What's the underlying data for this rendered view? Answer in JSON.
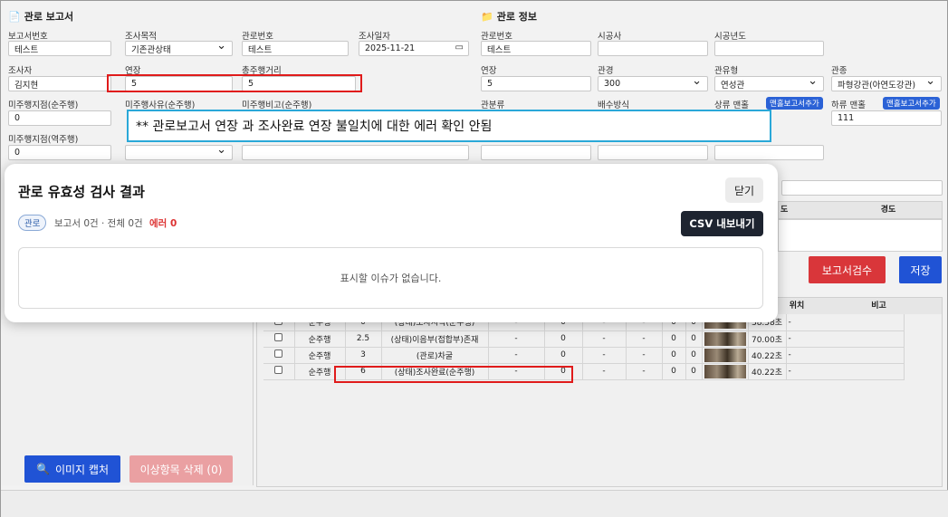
{
  "report": {
    "title": "관로 보고서",
    "fields": {
      "report_no": {
        "label": "보고서번호",
        "value": "테스트"
      },
      "purpose": {
        "label": "조사목적",
        "value": "기존관상태"
      },
      "pipe_no": {
        "label": "관로번호",
        "value": "테스트"
      },
      "date": {
        "label": "조사일자",
        "value": "2025-11-21"
      },
      "inspector": {
        "label": "조사자",
        "value": "김지현"
      },
      "length": {
        "label": "연장",
        "value": "5"
      },
      "total_distance": {
        "label": "총주행거리",
        "value": "5"
      },
      "unrun_point_fwd": {
        "label": "미주행지점(순주행)",
        "value": "0"
      },
      "unrun_reason_fwd": {
        "label": "미주행사유(순주행)",
        "value": ""
      },
      "unrun_note_fwd": {
        "label": "미주행비고(순주행)",
        "value": ""
      },
      "unrun_point_rev": {
        "label": "미주행지점(역주행)",
        "value": "0"
      }
    }
  },
  "pipe_info": {
    "title": "관로 정보",
    "fields": {
      "pipe_no": {
        "label": "관로번호",
        "value": "테스트"
      },
      "contractor": {
        "label": "시공사",
        "value": ""
      },
      "year": {
        "label": "시공년도",
        "value": ""
      },
      "length": {
        "label": "연장",
        "value": "5"
      },
      "diameter": {
        "label": "관경",
        "value": "300"
      },
      "pipe_type": {
        "label": "관유형",
        "value": "연성관"
      },
      "pipe_kind": {
        "label": "관종",
        "value": "파형강관(아연도강관)"
      },
      "category": {
        "label": "관분류"
      },
      "drainage": {
        "label": "배수방식"
      },
      "upstream_manhole": {
        "label": "상류 맨홀",
        "btn": "맨홀보고서추가"
      },
      "downstream_manhole": {
        "label": "하류 맨홀",
        "btn": "맨홀보고서추가",
        "value": "111"
      }
    }
  },
  "callout": {
    "text": "** 관로보고서 연장 과 조사완료 연장 불일치에 대한 에러 확인 안됨"
  },
  "modal": {
    "title": "관로 유효성 검사 결과",
    "close": "닫기",
    "tag": "관로",
    "summary": "보고서 0건 · 전체 0건",
    "error": "에러 0",
    "csv": "CSV 내보내기",
    "empty": "표시할 이슈가 없습니다."
  },
  "bg_table": {
    "col_do": "도",
    "col_lng": "경도",
    "col_pos": "위치",
    "col_note": "비고"
  },
  "buttons": {
    "report_check": "보고서검수",
    "save": "저장",
    "capture": "이미지 캡처",
    "delete": "이상항목 삭제 (0)"
  },
  "rows": [
    {
      "dir": "순주행",
      "dist": "0",
      "desc": "(상태)조사시작(순주행)",
      "a": "-",
      "b": "0",
      "c": "-",
      "d": "-",
      "e": "0",
      "f": "0",
      "pos": "38.58초",
      "note": "-"
    },
    {
      "dir": "순주행",
      "dist": "2.5",
      "desc": "(상태)이음부(접합부)존재",
      "a": "-",
      "b": "0",
      "c": "-",
      "d": "-",
      "e": "0",
      "f": "0",
      "pos": "70.00초",
      "note": "-"
    },
    {
      "dir": "순주행",
      "dist": "3",
      "desc": "(관로)차굴",
      "a": "-",
      "b": "0",
      "c": "-",
      "d": "-",
      "e": "0",
      "f": "0",
      "pos": "40.22초",
      "note": "-"
    },
    {
      "dir": "순주행",
      "dist": "6",
      "desc": "(상태)조사완료(순주행)",
      "a": "-",
      "b": "0",
      "c": "-",
      "d": "-",
      "e": "0",
      "f": "0",
      "pos": "40.22초",
      "note": "-"
    }
  ]
}
